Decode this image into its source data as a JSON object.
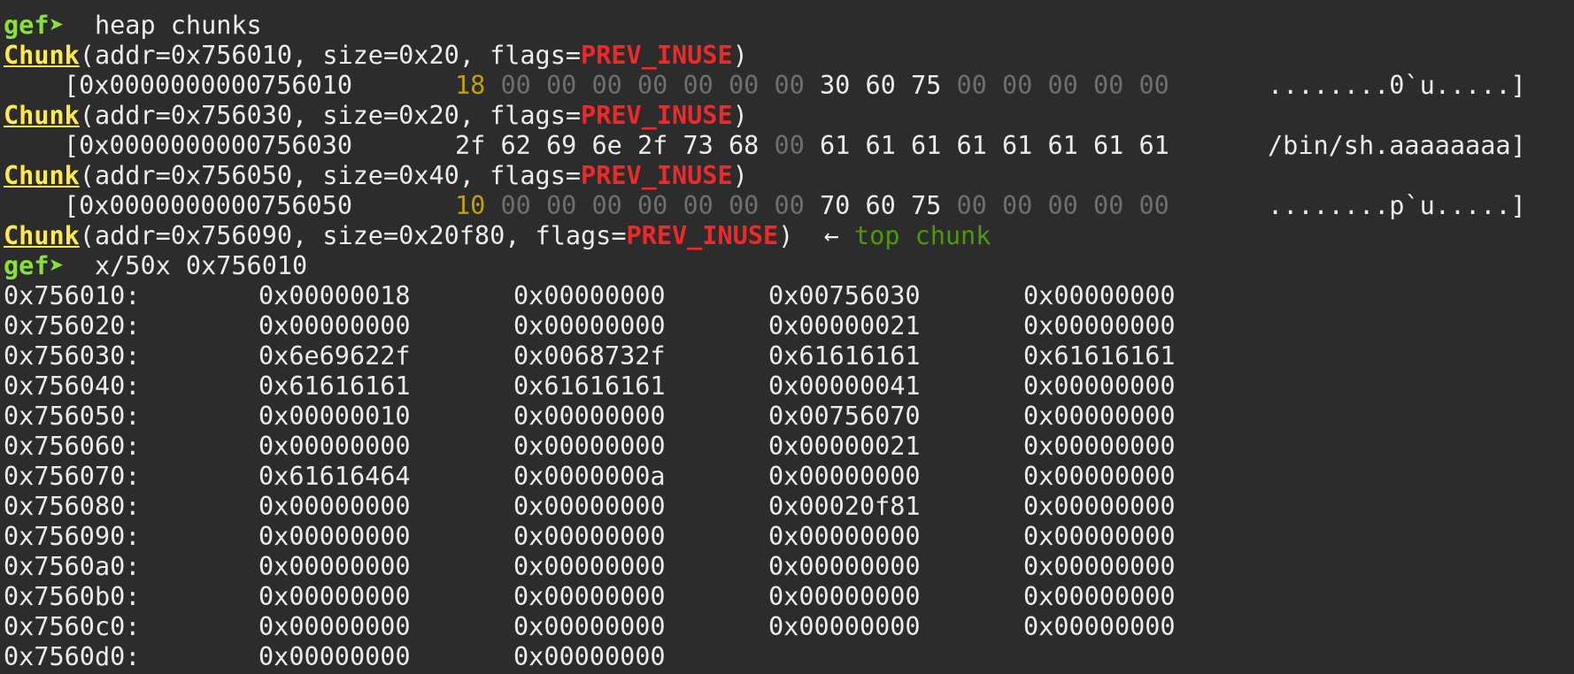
{
  "prompt": "gef➤",
  "cmd1": "heap chunks",
  "cmd2": "x/50x 0x756010",
  "chunk_label": "Chunk",
  "flag_label": "PREV_INUSE",
  "top_arrow": "←",
  "top_label": "top chunk",
  "chunks": [
    {
      "sig": "(addr=0x756010, size=0x20, flags=",
      "dump_addr": "[0x0000000000756010",
      "bytes": [
        [
          "18",
          "y"
        ],
        [
          "00",
          "d"
        ],
        [
          "00",
          "d"
        ],
        [
          "00",
          "d"
        ],
        [
          "00",
          "d"
        ],
        [
          "00",
          "d"
        ],
        [
          "00",
          "d"
        ],
        [
          "00",
          "d"
        ],
        [
          "30",
          "n"
        ],
        [
          "60",
          "n"
        ],
        [
          "75",
          "n"
        ],
        [
          "00",
          "d"
        ],
        [
          "00",
          "d"
        ],
        [
          "00",
          "d"
        ],
        [
          "00",
          "d"
        ],
        [
          "00",
          "d"
        ]
      ],
      "ascii": "........0`u.....]"
    },
    {
      "sig": "(addr=0x756030, size=0x20, flags=",
      "dump_addr": "[0x0000000000756030",
      "bytes": [
        [
          "2f",
          "n"
        ],
        [
          "62",
          "n"
        ],
        [
          "69",
          "n"
        ],
        [
          "6e",
          "n"
        ],
        [
          "2f",
          "n"
        ],
        [
          "73",
          "n"
        ],
        [
          "68",
          "n"
        ],
        [
          "00",
          "d"
        ],
        [
          "61",
          "n"
        ],
        [
          "61",
          "n"
        ],
        [
          "61",
          "n"
        ],
        [
          "61",
          "n"
        ],
        [
          "61",
          "n"
        ],
        [
          "61",
          "n"
        ],
        [
          "61",
          "n"
        ],
        [
          "61",
          "n"
        ]
      ],
      "ascii": "/bin/sh.aaaaaaaa]"
    },
    {
      "sig": "(addr=0x756050, size=0x40, flags=",
      "dump_addr": "[0x0000000000756050",
      "bytes": [
        [
          "10",
          "y"
        ],
        [
          "00",
          "d"
        ],
        [
          "00",
          "d"
        ],
        [
          "00",
          "d"
        ],
        [
          "00",
          "d"
        ],
        [
          "00",
          "d"
        ],
        [
          "00",
          "d"
        ],
        [
          "00",
          "d"
        ],
        [
          "70",
          "n"
        ],
        [
          "60",
          "n"
        ],
        [
          "75",
          "n"
        ],
        [
          "00",
          "d"
        ],
        [
          "00",
          "d"
        ],
        [
          "00",
          "d"
        ],
        [
          "00",
          "d"
        ],
        [
          "00",
          "d"
        ]
      ],
      "ascii": "........p`u.....]"
    }
  ],
  "top_chunk_sig": "(addr=0x756090, size=0x20f80, flags=",
  "close_paren": ")",
  "memory": [
    [
      "0x756010:",
      "0x00000018",
      "0x00000000",
      "0x00756030",
      "0x00000000"
    ],
    [
      "0x756020:",
      "0x00000000",
      "0x00000000",
      "0x00000021",
      "0x00000000"
    ],
    [
      "0x756030:",
      "0x6e69622f",
      "0x0068732f",
      "0x61616161",
      "0x61616161"
    ],
    [
      "0x756040:",
      "0x61616161",
      "0x61616161",
      "0x00000041",
      "0x00000000"
    ],
    [
      "0x756050:",
      "0x00000010",
      "0x00000000",
      "0x00756070",
      "0x00000000"
    ],
    [
      "0x756060:",
      "0x00000000",
      "0x00000000",
      "0x00000021",
      "0x00000000"
    ],
    [
      "0x756070:",
      "0x61616464",
      "0x0000000a",
      "0x00000000",
      "0x00000000"
    ],
    [
      "0x756080:",
      "0x00000000",
      "0x00000000",
      "0x00020f81",
      "0x00000000"
    ],
    [
      "0x756090:",
      "0x00000000",
      "0x00000000",
      "0x00000000",
      "0x00000000"
    ],
    [
      "0x7560a0:",
      "0x00000000",
      "0x00000000",
      "0x00000000",
      "0x00000000"
    ],
    [
      "0x7560b0:",
      "0x00000000",
      "0x00000000",
      "0x00000000",
      "0x00000000"
    ],
    [
      "0x7560c0:",
      "0x00000000",
      "0x00000000",
      "0x00000000",
      "0x00000000"
    ],
    [
      "0x7560d0:",
      "0x00000000",
      "0x00000000"
    ]
  ],
  "colors": {
    "background": "#2c2c2c",
    "prompt": "#8ae234",
    "chunk": "#fce94f",
    "flags": "#ef2929",
    "top": "#4e9a06",
    "dim": "#6f6f6f",
    "highlight": "#c4a000"
  }
}
